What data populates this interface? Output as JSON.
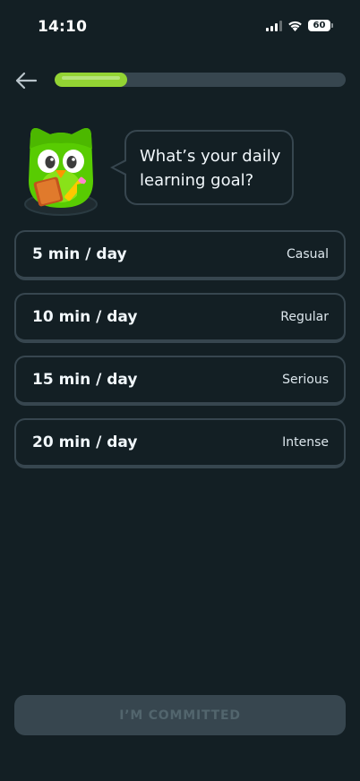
{
  "status_bar": {
    "time": "14:10",
    "battery": "60",
    "icons": [
      "signal-icon",
      "wifi-icon",
      "battery-icon"
    ]
  },
  "header": {
    "back_icon": "arrow-left-icon",
    "progress_fraction": 0.25
  },
  "prompt": {
    "line1": "What’s your daily",
    "line2": "learning goal?",
    "mascot_icon": "owl-mascot-icon"
  },
  "options": [
    {
      "time": "5 min / day",
      "level": "Casual"
    },
    {
      "time": "10 min / day",
      "level": "Regular"
    },
    {
      "time": "15 min / day",
      "level": "Serious"
    },
    {
      "time": "20 min / day",
      "level": "Intense"
    }
  ],
  "footer": {
    "commit_label": "I’M COMMITTED"
  },
  "colors": {
    "background": "#131f24",
    "border": "#37464f",
    "accent_green": "#93d333",
    "text": "#f1f7fb",
    "disabled_text": "#52656d"
  }
}
